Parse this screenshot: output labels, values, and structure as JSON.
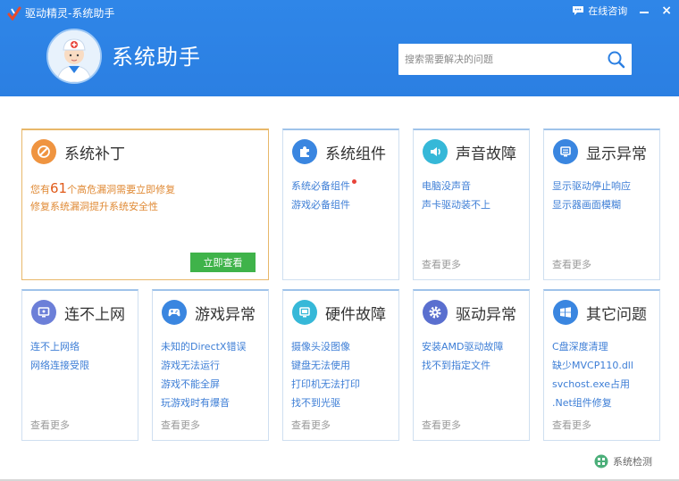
{
  "window": {
    "title": "驱动精灵-系统助手",
    "online_consult": "在线咨询"
  },
  "header": {
    "app_title": "系统助手",
    "search_placeholder": "搜索需要解决的问题"
  },
  "patch_card": {
    "title": "系统补丁",
    "line1_prefix": "您有",
    "count": "61",
    "line1_suffix": "个高危漏洞需要立即修复",
    "line2": "修复系统漏洞提升系统安全性",
    "button": "立即查看"
  },
  "cards": [
    {
      "id": "components",
      "title": "系统组件",
      "icon": "puzzle-icon",
      "color": "#3a86e0",
      "links": [
        "系统必备组件",
        "游戏必备组件"
      ],
      "more": ""
    },
    {
      "id": "sound",
      "title": "声音故障",
      "icon": "speaker-icon",
      "color": "#36b8d8",
      "links": [
        "电脑没声音",
        "声卡驱动装不上"
      ],
      "more": "查看更多"
    },
    {
      "id": "display",
      "title": "显示异常",
      "icon": "monitor-icon",
      "color": "#3a86e0",
      "links": [
        "显示驱动停止响应",
        "显示器画面模糊"
      ],
      "more": "查看更多"
    },
    {
      "id": "network",
      "title": "连不上网",
      "icon": "network-monitor-icon",
      "color": "#6c7fd8",
      "links": [
        "连不上网络",
        "网络连接受限"
      ],
      "more": "查看更多"
    },
    {
      "id": "game",
      "title": "游戏异常",
      "icon": "gamepad-icon",
      "color": "#3a86e0",
      "links": [
        "未知的DirectX错误",
        "游戏无法运行",
        "游戏不能全屏",
        "玩游戏时有爆音"
      ],
      "more": "查看更多"
    },
    {
      "id": "hardware",
      "title": "硬件故障",
      "icon": "hardware-icon",
      "color": "#36b8d8",
      "links": [
        "摄像头没图像",
        "键盘无法使用",
        "打印机无法打印",
        "找不到光驱"
      ],
      "more": "查看更多"
    },
    {
      "id": "driver",
      "title": "驱动异常",
      "icon": "gear-icon",
      "color": "#5a6fcf",
      "links": [
        "安装AMD驱动故障",
        "找不到指定文件"
      ],
      "more": "查看更多"
    },
    {
      "id": "other",
      "title": "其它问题",
      "icon": "windows-icon",
      "color": "#3a86e0",
      "links": [
        "C盘深度清理",
        "缺少MVCP110.dll",
        "svchost.exe占用",
        ".Net组件修复"
      ],
      "more": "查看更多"
    }
  ],
  "footer": {
    "system_check": "系统检测"
  }
}
